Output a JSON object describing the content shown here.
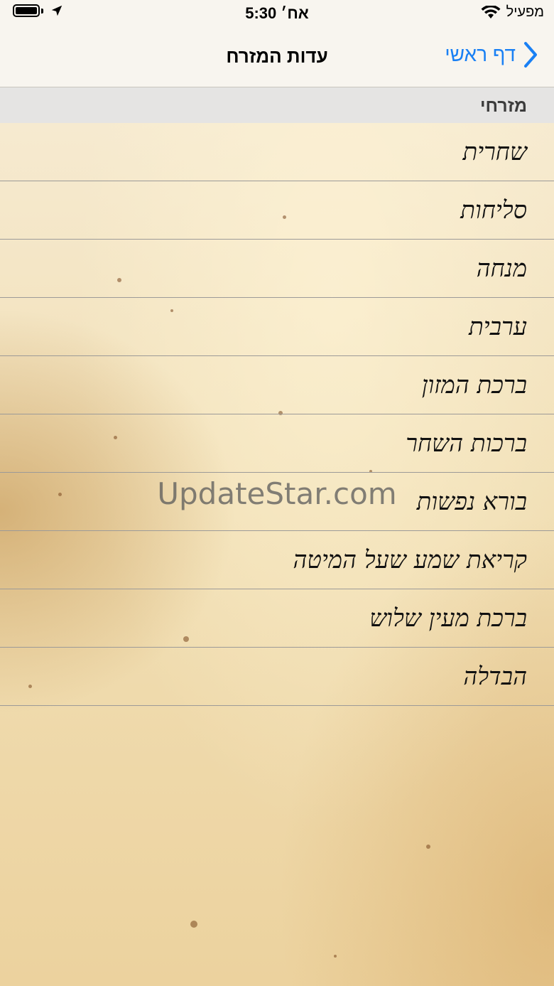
{
  "status_bar": {
    "time": "5:30 אח׳",
    "carrier": "מפעיל",
    "icons": [
      "battery-icon",
      "location-icon",
      "wifi-icon"
    ]
  },
  "nav": {
    "title": "עדות המזרח",
    "back_label": "דף ראשי",
    "accent_color": "#1a80f4"
  },
  "section": {
    "header": "מזרחי"
  },
  "items": [
    {
      "label": "שחרית"
    },
    {
      "label": "סליחות"
    },
    {
      "label": "מנחה"
    },
    {
      "label": "ערבית"
    },
    {
      "label": "ברכת המזון"
    },
    {
      "label": "ברכות השחר"
    },
    {
      "label": "בורא נפשות"
    },
    {
      "label": "קריאת שמע שעל המיטה"
    },
    {
      "label": "ברכת מעין שלוש"
    },
    {
      "label": "הבדלה"
    }
  ],
  "watermark": "UpdateStar.com"
}
